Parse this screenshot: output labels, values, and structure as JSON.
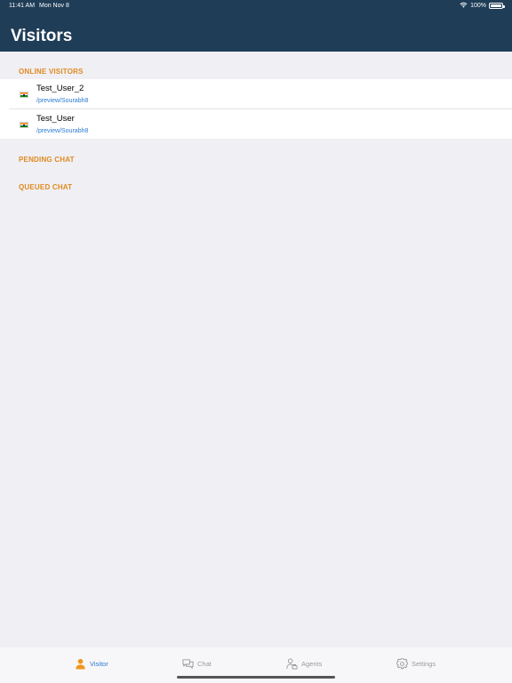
{
  "status_bar": {
    "time": "11:41 AM",
    "date": "Mon Nov 8",
    "battery": "100%"
  },
  "header": {
    "title": "Visitors"
  },
  "sections": {
    "online": "ONLINE VISITORS",
    "pending": "PENDING CHAT",
    "queued": "QUEUED CHAT"
  },
  "visitors": [
    {
      "name": "Test_User_2",
      "path": "/preview/Sourabh8",
      "flag": "india-flag-icon"
    },
    {
      "name": "Test_User",
      "path": "/preview/Sourabh8",
      "flag": "india-flag-icon"
    }
  ],
  "tabs": [
    {
      "label": "Visitor",
      "icon": "person-icon",
      "active": true
    },
    {
      "label": "Chat",
      "icon": "chat-bubbles-icon",
      "active": false
    },
    {
      "label": "Agents",
      "icon": "agents-icon",
      "active": false
    },
    {
      "label": "Settings",
      "icon": "gear-icon",
      "active": false
    }
  ],
  "colors": {
    "header": "#1f3d57",
    "accent": "#2a7ad2",
    "section_header": "#e08a1e",
    "background": "#efeff4"
  }
}
